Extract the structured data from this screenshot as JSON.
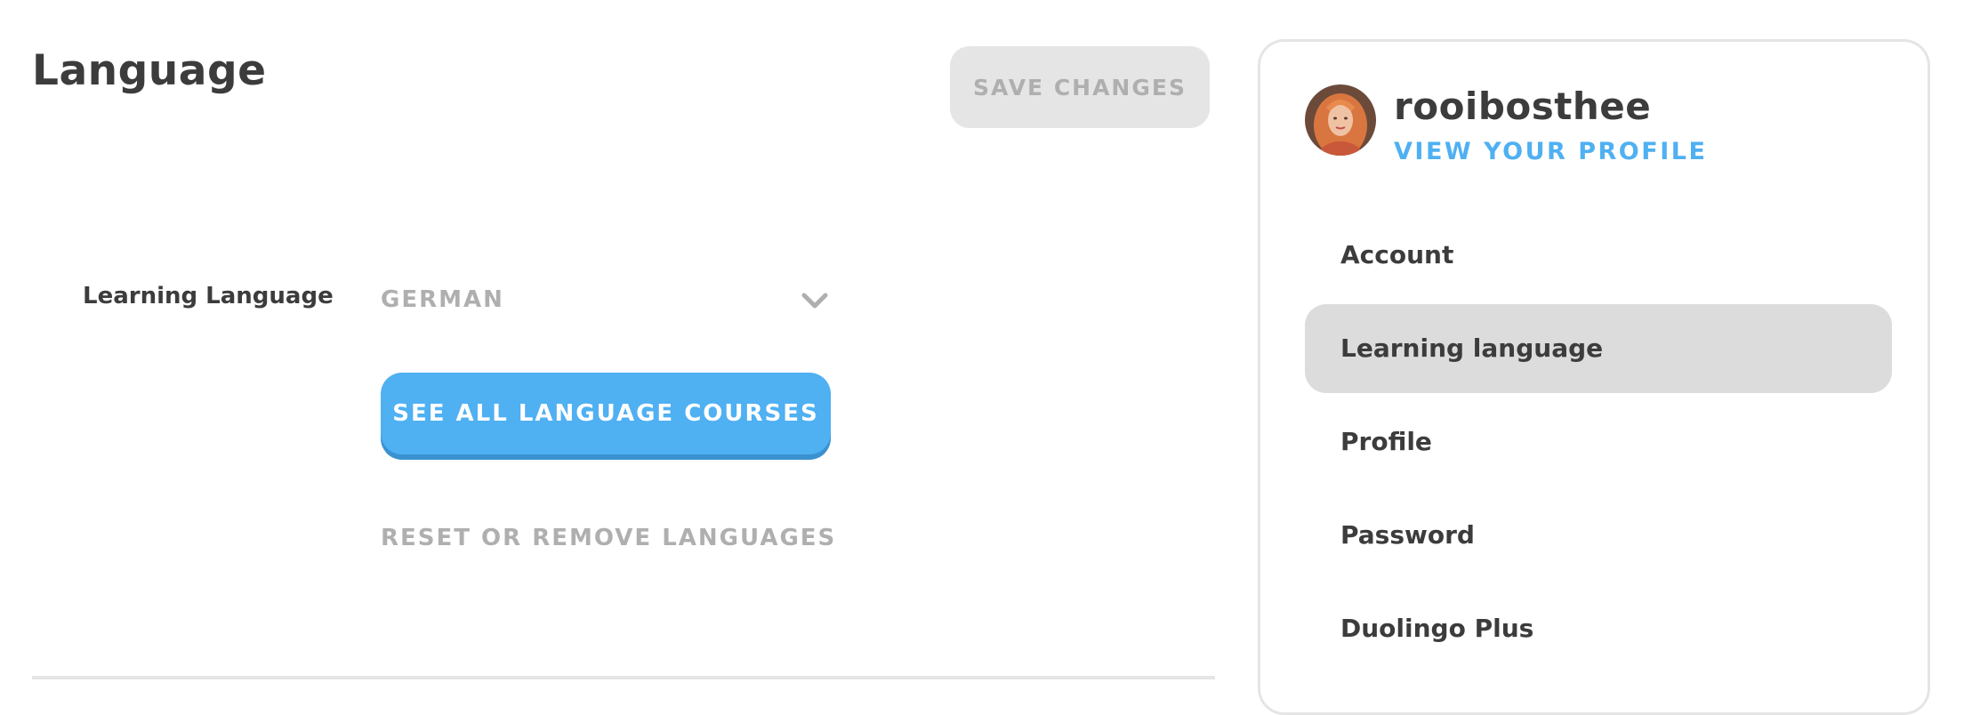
{
  "page": {
    "title": "Language",
    "save_label": "SAVE CHANGES"
  },
  "learning_language": {
    "label": "Learning Language",
    "selected": "GERMAN",
    "dropdown_icon": "chevron-down-icon"
  },
  "actions": {
    "see_all_courses": "SEE ALL LANGUAGE COURSES",
    "reset_remove": "RESET OR REMOVE LANGUAGES"
  },
  "profile": {
    "username": "rooibosthee",
    "view_profile": "VIEW YOUR PROFILE",
    "avatar_icon": "user-avatar"
  },
  "sidebar": {
    "items": [
      {
        "label": "Account",
        "active": false
      },
      {
        "label": "Learning language",
        "active": true
      },
      {
        "label": "Profile",
        "active": false
      },
      {
        "label": "Password",
        "active": false
      },
      {
        "label": "Duolingo Plus",
        "active": false
      }
    ]
  },
  "colors": {
    "accent_blue": "#4fb0f2",
    "button_shadow_blue": "#3a91d0",
    "text_dark": "#3c3c3c",
    "text_muted": "#afafaf",
    "disabled_bg": "#e5e5e5",
    "active_nav_bg": "#dcdcdc"
  }
}
